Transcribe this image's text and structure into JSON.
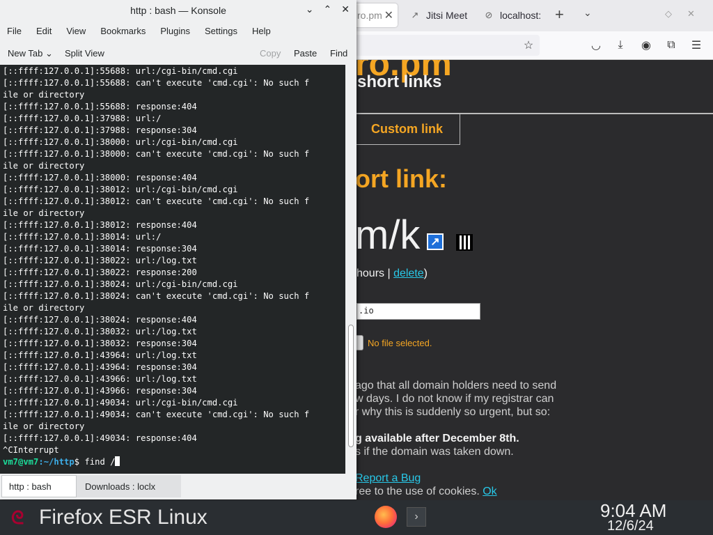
{
  "firefox": {
    "tabs": [
      {
        "label": "ro.pm",
        "active": true
      },
      {
        "label": "Jitsi Meet",
        "active": false
      },
      {
        "label": "localhost:",
        "active": false
      }
    ],
    "toolbar_icons": [
      "star-icon",
      "pocket-icon",
      "download-icon",
      "account-icon",
      "extensions-icon",
      "menu-icon"
    ]
  },
  "website": {
    "logo_fragment": "ro.pm",
    "tagline": "short links",
    "nav_tab": "Custom link",
    "heading": "ort link:",
    "short_url": "m/k",
    "expire_prefix": "hours | ",
    "delete_link": "delete",
    "expire_suffix": ")",
    "textarea_value": ".io",
    "file_status": "No file selected.",
    "notice_lines": [
      "ago that all domain holders need to send",
      "w days. I do not know if my registrar can",
      "r why this is suddenly so urgent, but so:"
    ],
    "notice_bold": "g available after December 8th.",
    "notice_sub": "s if the domain was taken down.",
    "report_bug": "Report a Bug",
    "cookie_text": "ree to the use of cookies. ",
    "cookie_ok": "Ok"
  },
  "konsole": {
    "title": "http : bash — Konsole",
    "menu": [
      "File",
      "Edit",
      "View",
      "Bookmarks",
      "Plugins",
      "Settings",
      "Help"
    ],
    "toolbar": {
      "new_tab": "New Tab",
      "split_view": "Split View",
      "copy": "Copy",
      "paste": "Paste",
      "find": "Find"
    },
    "lines": [
      "[::ffff:127.0.0.1]:55688: url:/cgi-bin/cmd.cgi",
      "[::ffff:127.0.0.1]:55688: can't execute 'cmd.cgi': No such f",
      "ile or directory",
      "[::ffff:127.0.0.1]:55688: response:404",
      "[::ffff:127.0.0.1]:37988: url:/",
      "[::ffff:127.0.0.1]:37988: response:304",
      "[::ffff:127.0.0.1]:38000: url:/cgi-bin/cmd.cgi",
      "[::ffff:127.0.0.1]:38000: can't execute 'cmd.cgi': No such f",
      "ile or directory",
      "[::ffff:127.0.0.1]:38000: response:404",
      "[::ffff:127.0.0.1]:38012: url:/cgi-bin/cmd.cgi",
      "[::ffff:127.0.0.1]:38012: can't execute 'cmd.cgi': No such f",
      "ile or directory",
      "[::ffff:127.0.0.1]:38012: response:404",
      "[::ffff:127.0.0.1]:38014: url:/",
      "[::ffff:127.0.0.1]:38014: response:304",
      "[::ffff:127.0.0.1]:38022: url:/log.txt",
      "[::ffff:127.0.0.1]:38022: response:200",
      "[::ffff:127.0.0.1]:38024: url:/cgi-bin/cmd.cgi",
      "[::ffff:127.0.0.1]:38024: can't execute 'cmd.cgi': No such f",
      "ile or directory",
      "[::ffff:127.0.0.1]:38024: response:404",
      "[::ffff:127.0.0.1]:38032: url:/log.txt",
      "[::ffff:127.0.0.1]:38032: response:304",
      "[::ffff:127.0.0.1]:43964: url:/log.txt",
      "[::ffff:127.0.0.1]:43964: response:304",
      "[::ffff:127.0.0.1]:43966: url:/log.txt",
      "[::ffff:127.0.0.1]:43966: response:304",
      "[::ffff:127.0.0.1]:49034: url:/cgi-bin/cmd.cgi",
      "[::ffff:127.0.0.1]:49034: can't execute 'cmd.cgi': No such f",
      "ile or directory",
      "[::ffff:127.0.0.1]:49034: response:404",
      "^CInterrupt"
    ],
    "prompt_user": "vm7@vm7",
    "prompt_path": ":~/http",
    "prompt_symbol": "$ ",
    "command": "find /",
    "tabs": [
      "http : bash",
      "Downloads : loclx"
    ]
  },
  "taskbar": {
    "window_title": "Firefox ESR Linux",
    "clock_time": "9:04 AM",
    "clock_date": "12/6/24"
  },
  "colors": {
    "accent_orange": "#f5a623",
    "link_cyan": "#28c8e8",
    "terminal_bg": "#232627",
    "prompt_green": "#1cdc9a",
    "prompt_blue": "#3daee9"
  }
}
